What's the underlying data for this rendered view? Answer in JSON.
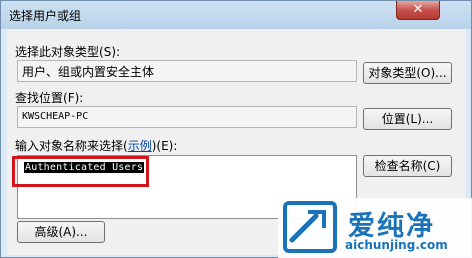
{
  "window": {
    "title": "选择用户或组",
    "close_glyph": "✕"
  },
  "object_type": {
    "label": "选择此对象类型",
    "accesskey": "(S):",
    "value": "用户、组或内置安全主体",
    "button": "对象类型(O)..."
  },
  "location": {
    "label": "查找位置",
    "accesskey": "(F):",
    "value": "KWSCHEAP-PC",
    "button": "位置(L)..."
  },
  "names": {
    "label_prefix": "输入对象名称来选择",
    "link_open": "(",
    "example_link": "示例",
    "label_suffix": ")(E):",
    "value": "Authenticated Users",
    "check_button": "检查名称(C)"
  },
  "advanced_button": "高级(A)...",
  "watermark": {
    "brand": "爱纯净",
    "url": "aichunjing.com"
  },
  "colors": {
    "annotation": "#d0151b",
    "brand": "#1a73b8",
    "close": "#c75050"
  }
}
